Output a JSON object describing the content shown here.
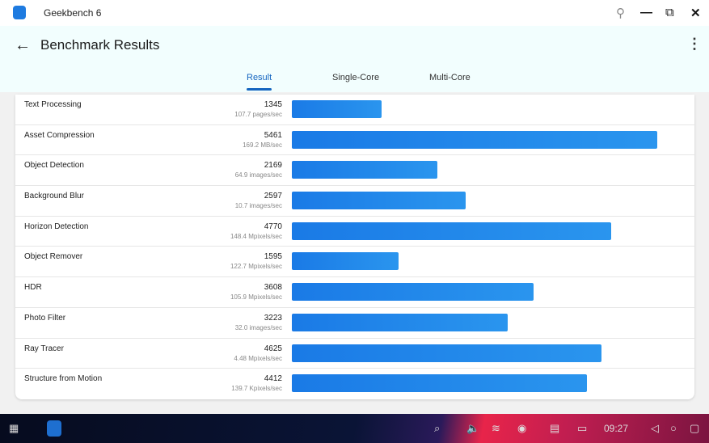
{
  "window": {
    "title": "Geekbench 6"
  },
  "header": {
    "title": "Benchmark Results"
  },
  "tabs": [
    {
      "label": "Result"
    },
    {
      "label": "Single-Core"
    },
    {
      "label": "Multi-Core"
    }
  ],
  "max_score": 5461,
  "rows": [
    {
      "name": "Text Processing",
      "score": 1345,
      "unit": "107.7 pages/sec"
    },
    {
      "name": "Asset Compression",
      "score": 5461,
      "unit": "169.2 MB/sec"
    },
    {
      "name": "Object Detection",
      "score": 2169,
      "unit": "64.9 images/sec"
    },
    {
      "name": "Background Blur",
      "score": 2597,
      "unit": "10.7 images/sec"
    },
    {
      "name": "Horizon Detection",
      "score": 4770,
      "unit": "148.4 Mpixels/sec"
    },
    {
      "name": "Object Remover",
      "score": 1595,
      "unit": "122.7 Mpixels/sec"
    },
    {
      "name": "HDR",
      "score": 3608,
      "unit": "105.9 Mpixels/sec"
    },
    {
      "name": "Photo Filter",
      "score": 3223,
      "unit": "32.0 images/sec"
    },
    {
      "name": "Ray Tracer",
      "score": 4625,
      "unit": "4.48 Mpixels/sec"
    },
    {
      "name": "Structure from Motion",
      "score": 4412,
      "unit": "139.7 Kpixels/sec"
    }
  ],
  "taskbar": {
    "time": "09:27"
  }
}
